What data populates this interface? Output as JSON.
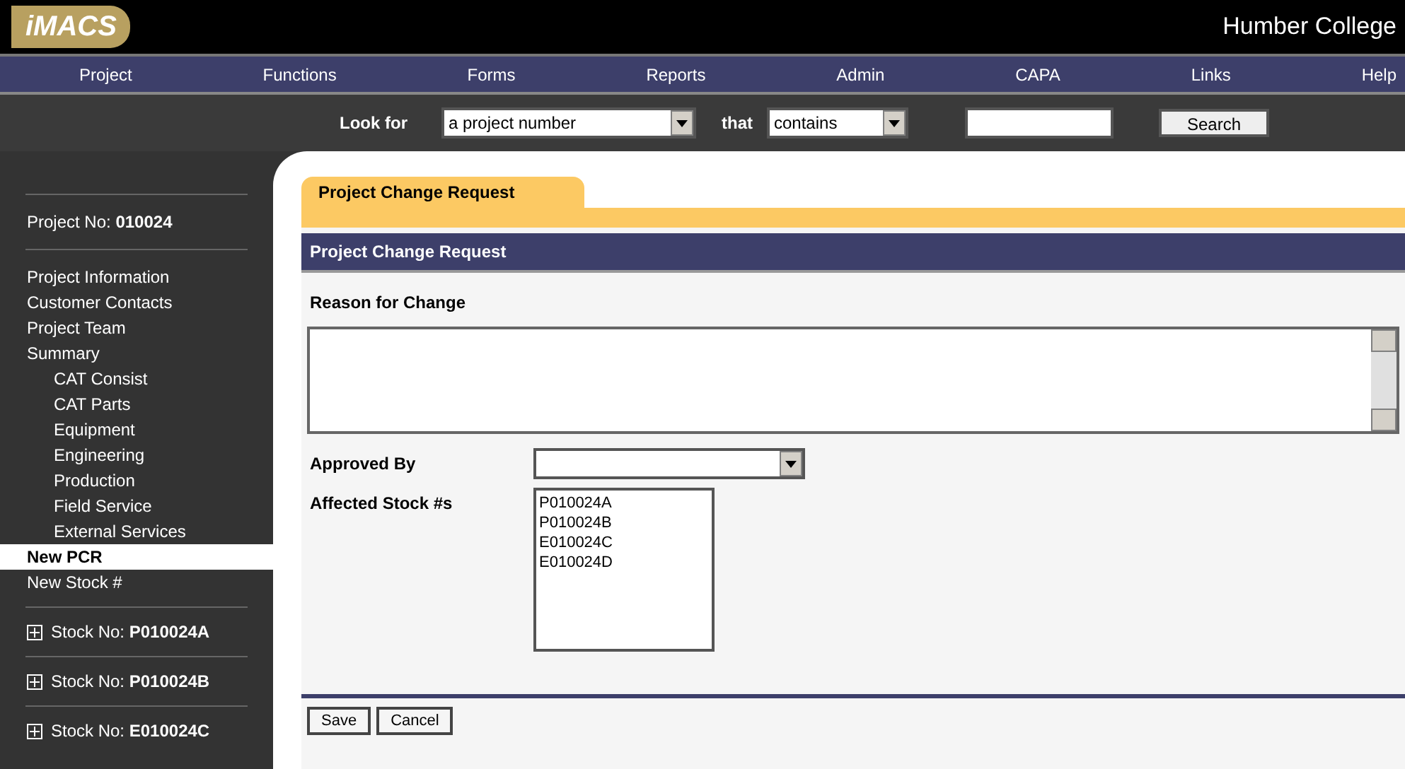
{
  "header": {
    "logo": "iMACS",
    "org": "Humber College"
  },
  "menu": [
    {
      "label": "Project"
    },
    {
      "label": "Functions"
    },
    {
      "label": "Forms"
    },
    {
      "label": "Reports"
    },
    {
      "label": "Admin"
    },
    {
      "label": "CAPA"
    },
    {
      "label": "Links"
    },
    {
      "label": "Help"
    }
  ],
  "search": {
    "label": "Look for",
    "field": "a project number",
    "connector": "that",
    "match": "contains",
    "button": "Search"
  },
  "sidebar": {
    "project_label": "Project No:",
    "project_value": "010024",
    "items": [
      {
        "label": "Project Information",
        "selected": false
      },
      {
        "label": "Customer Contacts",
        "selected": false
      },
      {
        "label": "Project Team",
        "selected": false
      },
      {
        "label": "Summary",
        "selected": false,
        "children": [
          {
            "label": "CAT Consist",
            "selected": false
          },
          {
            "label": "CAT Parts",
            "selected": false
          },
          {
            "label": "Equipment",
            "selected": false
          },
          {
            "label": "Engineering",
            "selected": false
          },
          {
            "label": "Production",
            "selected": false
          },
          {
            "label": "Field Service",
            "selected": false
          },
          {
            "label": "External Services",
            "selected": false
          }
        ]
      },
      {
        "label": "New PCR",
        "selected": true
      },
      {
        "label": "New Stock #",
        "selected": false
      }
    ],
    "stocks": [
      {
        "label": "Stock No:",
        "value": "P010024A",
        "expanded": false
      },
      {
        "label": "Stock No:",
        "value": "P010024B",
        "expanded": false
      },
      {
        "label": "Stock No:",
        "value": "E010024C",
        "expanded": false
      }
    ]
  },
  "tab": {
    "label": "Project Change Request"
  },
  "form": {
    "title": "Project Change Request",
    "reason_label": "Reason for Change",
    "approved_label": "Approved By",
    "affected_label": "Affected Stock #s",
    "affected": [
      "P010024A",
      "P010024B",
      "E010024C",
      "E010024D"
    ],
    "buttons": [
      "Save",
      "Cancel"
    ]
  }
}
